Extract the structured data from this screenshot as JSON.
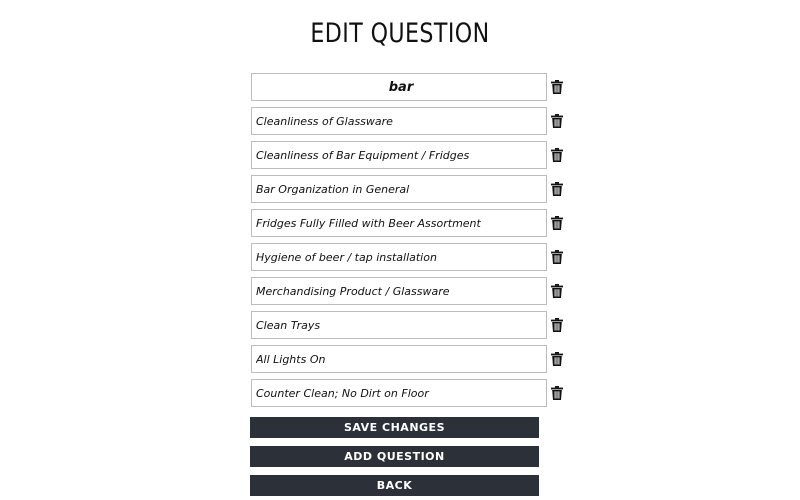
{
  "page": {
    "title": "EDIT QUESTION"
  },
  "category": {
    "name": "bar"
  },
  "questions": [
    "Cleanliness of Glassware",
    "Cleanliness of Bar Equipment / Fridges",
    "Bar Organization in General",
    "Fridges Fully Filled with Beer Assortment",
    "Hygiene of beer / tap installation",
    "Merchandising Product / Glassware",
    "Clean Trays",
    "All Lights On",
    "Counter Clean; No Dirt on Floor"
  ],
  "icons": {
    "delete": "trash-icon"
  },
  "buttons": {
    "save": "SAVE CHANGES",
    "add": "ADD QUESTION",
    "back": "BACK"
  },
  "colors": {
    "button_bg": "#2b3039",
    "button_text": "#ffffff",
    "field_border": "#bcbcbc"
  }
}
